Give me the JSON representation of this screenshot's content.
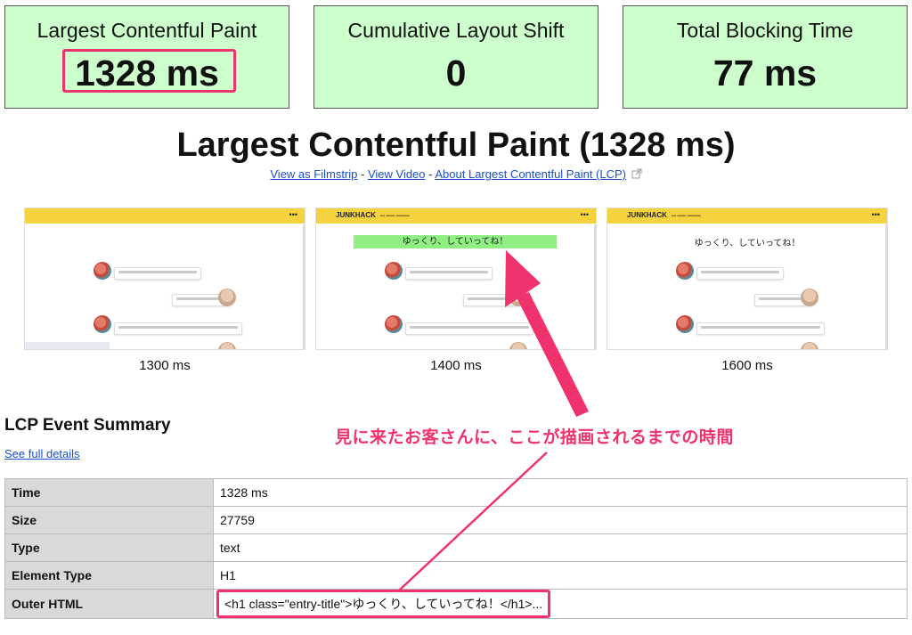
{
  "metrics": [
    {
      "label": "Largest Contentful Paint",
      "value": "1328 ms"
    },
    {
      "label": "Cumulative Layout Shift",
      "value": "0"
    },
    {
      "label": "Total Blocking Time",
      "value": "77 ms"
    }
  ],
  "title": "Largest Contentful Paint (1328 ms)",
  "links": {
    "filmstrip": "View as Filmstrip",
    "video": "View Video",
    "about": "About Largest Contentful Paint (LCP)",
    "sep": " - "
  },
  "frames": [
    {
      "time": "1300 ms",
      "brand": "",
      "heading": "",
      "highlighted": false
    },
    {
      "time": "1400 ms",
      "brand": "JUNKHACK",
      "heading": "ゆっくり、していってね！",
      "highlighted": true
    },
    {
      "time": "1600 ms",
      "brand": "JUNKHACK",
      "heading": "ゆっくり、していってね！",
      "highlighted": false
    }
  ],
  "frame_menu": "•••",
  "summary": {
    "title": "LCP Event Summary",
    "details_link": "See full details",
    "rows": [
      {
        "key": "Time",
        "value": "1328 ms"
      },
      {
        "key": "Size",
        "value": "27759"
      },
      {
        "key": "Type",
        "value": "text"
      },
      {
        "key": "Element Type",
        "value": "H1"
      },
      {
        "key": "Outer HTML",
        "value": "<h1 class=\"entry-title\">ゆっくり、していってね！</h1>..."
      }
    ]
  },
  "annotation": "見に来たお客さんに、ここが描画されるまでの時間",
  "colors": {
    "metric_bg": "#ccffcc",
    "accent_pink": "#f0336d",
    "frame_header": "#f5d33e",
    "lcp_highlight": "#8fef83",
    "link": "#1a4fc9"
  },
  "icons": {
    "external_link": "external-link-icon"
  }
}
